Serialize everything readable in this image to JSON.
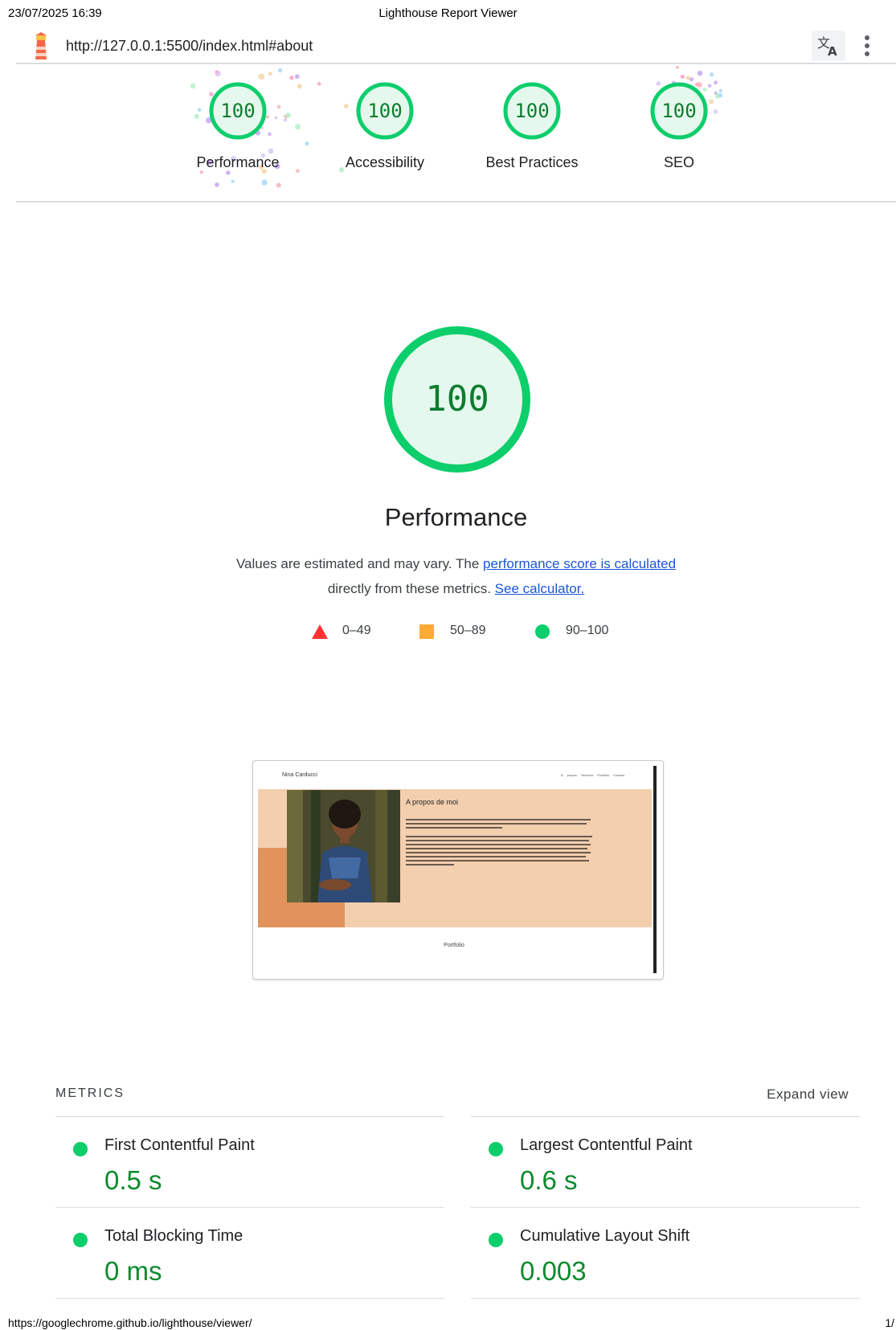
{
  "print": {
    "datetime": "23/07/2025 16:39",
    "title": "Lighthouse Report Viewer",
    "footer_url": "https://googlechrome.github.io/lighthouse/viewer/",
    "page_number": "1/"
  },
  "topbar": {
    "url": "http://127.0.0.1:5500/index.html#about",
    "icons": [
      "lighthouse-logo-icon",
      "translate-icon",
      "more-vert-icon"
    ]
  },
  "gauges": [
    {
      "score": "100",
      "label": "Performance"
    },
    {
      "score": "100",
      "label": "Accessibility"
    },
    {
      "score": "100",
      "label": "Best Practices"
    },
    {
      "score": "100",
      "label": "SEO"
    }
  ],
  "performance": {
    "score": "100",
    "title": "Performance",
    "desc_text_1": "Values are estimated and may vary. The ",
    "desc_link_1": "performance score is calculated",
    "desc_text_2": "directly from these metrics. ",
    "desc_link_2": "See calculator."
  },
  "legend": [
    {
      "shape": "triangle",
      "range": "0–49",
      "color": "#ff3333"
    },
    {
      "shape": "square",
      "range": "50–89",
      "color": "#ffaa33"
    },
    {
      "shape": "circle",
      "range": "90–100",
      "color": "#0cce6b"
    }
  ],
  "screenshot": {
    "brand": "Nina Carducci",
    "nav": "À propos   Services   Portfolio   Contact",
    "heading": "A propos de moi",
    "button": "Portfolio"
  },
  "metrics": {
    "title": "METRICS",
    "expand_label": "Expand view",
    "items": [
      {
        "label": "First Contentful Paint",
        "value": "0.5 s"
      },
      {
        "label": "Largest Contentful Paint",
        "value": "0.6 s"
      },
      {
        "label": "Total Blocking Time",
        "value": "0 ms"
      },
      {
        "label": "Cumulative Layout Shift",
        "value": "0.003"
      }
    ]
  },
  "colors": {
    "pass": "#0cce6b",
    "pass_text": "#0c7d2e",
    "pass_fill": "#e5f8ed",
    "link": "#1a57d6"
  }
}
